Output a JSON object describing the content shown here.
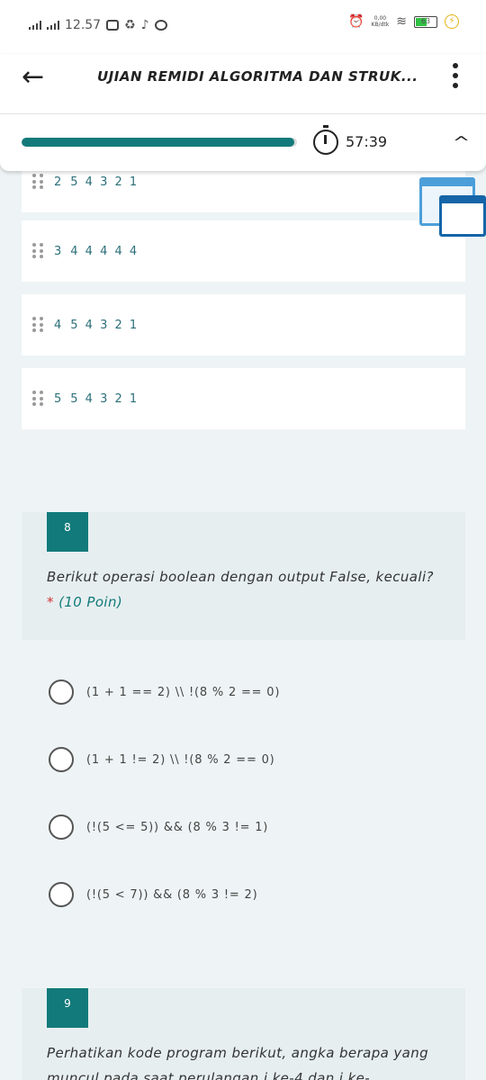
{
  "status_bar": {
    "time": "12.57",
    "net_speed": "0,00",
    "net_unit": "KB/dtk",
    "battery": "63",
    "charging_icon": "bolt-icon"
  },
  "header": {
    "title": "UJIAN REMIDI ALGORITMA DAN STRUK...",
    "timer": "57:39",
    "progress": 0.99
  },
  "answer_rows": [
    {
      "num": "2",
      "value": "5 4 3 2 1"
    },
    {
      "num": "3",
      "value": "4 4 4 4 4"
    },
    {
      "num": "4",
      "value": "5 4 3 2 1"
    },
    {
      "num": "5",
      "value": "5 4 3 2 1"
    }
  ],
  "question8": {
    "number": "8",
    "text": "Berikut operasi boolean dengan output False, kecuali?",
    "required": "*",
    "points": "(10 Poin)",
    "options": [
      "(1 + 1 == 2) \\\\ !(8 % 2 == 0)",
      "(1 + 1 != 2) \\\\ !(8 % 2 == 0)",
      "(!(5 <= 5)) && (8 % 3 != 1)",
      "(!(5 < 7)) && (8 % 3 != 2)"
    ]
  },
  "question9": {
    "number": "9",
    "text": "Perhatikan kode program berikut, angka berapa yang muncul pada saat perulangan i ke-4 dan i ke-"
  }
}
